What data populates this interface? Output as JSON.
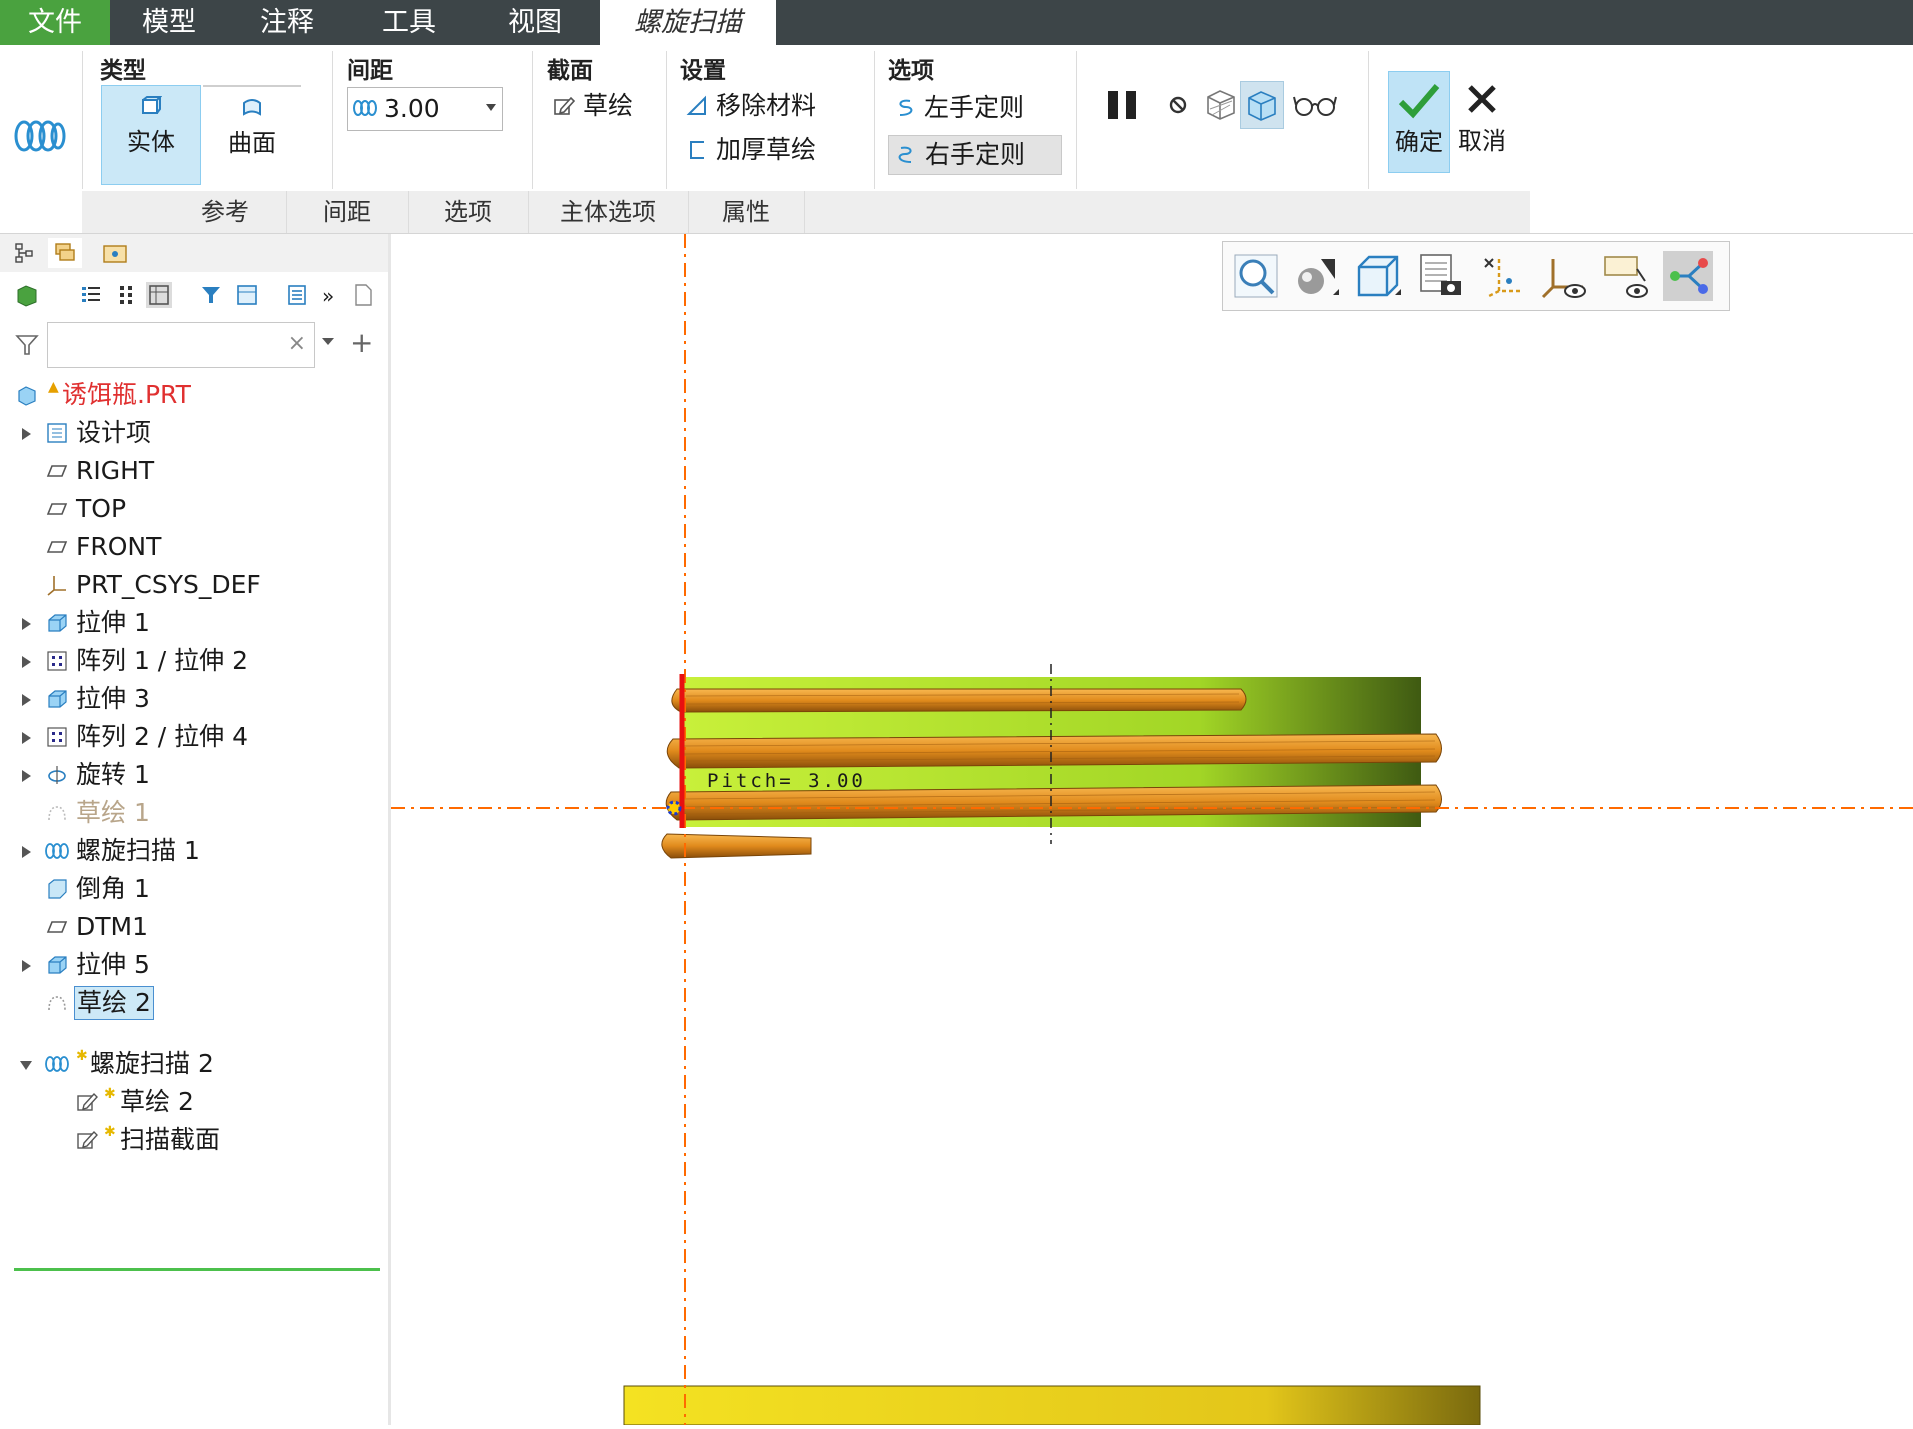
{
  "menu": {
    "tabs": [
      "文件",
      "模型",
      "注释",
      "工具",
      "视图",
      "螺旋扫描"
    ]
  },
  "ribbon": {
    "type_group": {
      "title": "类型",
      "solid": "实体",
      "surface": "曲面"
    },
    "pitch_group": {
      "title": "间距",
      "value": "3.00"
    },
    "section_group": {
      "title": "截面",
      "sketch": "草绘"
    },
    "settings_group": {
      "title": "设置",
      "remove_material": "移除材料",
      "thicken_sketch": "加厚草绘"
    },
    "options_group": {
      "title": "选项",
      "left_hand": "左手定则",
      "right_hand": "右手定则"
    },
    "ok": "确定",
    "cancel": "取消",
    "subtabs": [
      "参考",
      "间距",
      "选项",
      "主体选项",
      "属性"
    ]
  },
  "tree": {
    "filter_placeholder": "",
    "root": "诱饵瓶.PRT",
    "items": [
      {
        "label": "设计项"
      },
      {
        "label": "RIGHT"
      },
      {
        "label": "TOP"
      },
      {
        "label": "FRONT"
      },
      {
        "label": "PRT_CSYS_DEF"
      },
      {
        "label": "拉伸 1"
      },
      {
        "label": "阵列 1 / 拉伸 2"
      },
      {
        "label": "拉伸 3"
      },
      {
        "label": "阵列 2 / 拉伸 4"
      },
      {
        "label": "旋转 1"
      },
      {
        "label": "草绘 1"
      },
      {
        "label": "螺旋扫描 1"
      },
      {
        "label": "倒角 1"
      },
      {
        "label": "DTM1"
      },
      {
        "label": "拉伸 5"
      },
      {
        "label": "草绘 2"
      }
    ],
    "inserted": {
      "label": "螺旋扫描 2",
      "children": [
        "草绘 2",
        "扫描截面"
      ]
    }
  },
  "graphics": {
    "pitch_label": "Pitch= 3.00"
  },
  "colors": {
    "menubar": "#3d4548",
    "file_tab": "#4aa23f",
    "selected": "#cbe8f7",
    "thread": "#e8962a",
    "body": "#aee027",
    "datum": "#ff6a00"
  }
}
